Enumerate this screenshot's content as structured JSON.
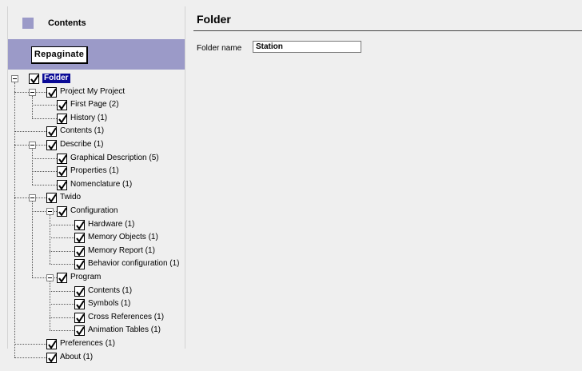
{
  "sidebar": {
    "title": "Contents",
    "repaginate_label": "Repaginate",
    "tree": [
      {
        "label": "Folder",
        "level": 0,
        "selected": true,
        "expander": true
      },
      {
        "label": "Project My Project",
        "level": 1,
        "expander": true
      },
      {
        "label": "First Page (2)",
        "level": 2
      },
      {
        "label": "History (1)",
        "level": 2
      },
      {
        "label": "Contents (1)",
        "level": 1
      },
      {
        "label": "Describe (1)",
        "level": 1,
        "expander": true
      },
      {
        "label": "Graphical Description (5)",
        "level": 2
      },
      {
        "label": "Properties (1)",
        "level": 2
      },
      {
        "label": "Nomenclature (1)",
        "level": 2
      },
      {
        "label": "Twido",
        "level": 1,
        "expander": true
      },
      {
        "label": "Configuration",
        "level": 2,
        "expander": true
      },
      {
        "label": "Hardware (1)",
        "level": 3
      },
      {
        "label": "Memory Objects (1)",
        "level": 3
      },
      {
        "label": "Memory Report (1)",
        "level": 3
      },
      {
        "label": "Behavior configuration (1)",
        "level": 3
      },
      {
        "label": "Program",
        "level": 2,
        "expander": true
      },
      {
        "label": "Contents (1)",
        "level": 3
      },
      {
        "label": "Symbols (1)",
        "level": 3
      },
      {
        "label": "Cross References (1)",
        "level": 3
      },
      {
        "label": "Animation Tables (1)",
        "level": 3
      },
      {
        "label": "Preferences (1)",
        "level": 1
      },
      {
        "label": "About (1)",
        "level": 1
      }
    ]
  },
  "main": {
    "title": "Folder",
    "folder_name_label": "Folder name",
    "folder_name_value": "Station"
  },
  "colors": {
    "accent": "#9b9ac8",
    "selection": "#0a0a96",
    "background": "#efefef"
  }
}
